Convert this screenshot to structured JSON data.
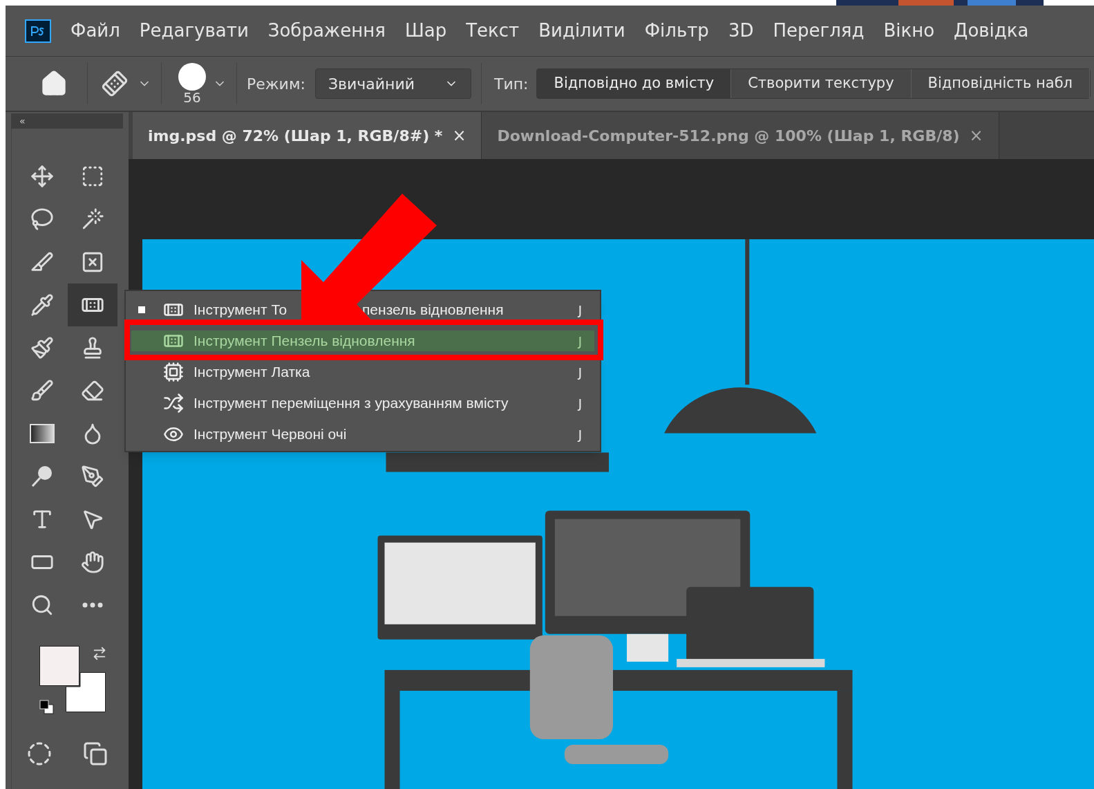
{
  "menu_bar": {
    "items": [
      "Файл",
      "Редагувати",
      "Зображення",
      "Шар",
      "Текст",
      "Виділити",
      "Фільтр",
      "3D",
      "Перегляд",
      "Вікно",
      "Довідка"
    ]
  },
  "options_bar": {
    "brush_size": "56",
    "mode_label": "Режим:",
    "mode_value": "Звичайний",
    "type_label": "Тип:",
    "type_buttons": [
      {
        "label": "Відповідно до вмісту",
        "selected": true
      },
      {
        "label": "Створити текстуру",
        "selected": false
      },
      {
        "label": "Відповідність набл",
        "selected": false
      }
    ]
  },
  "tabs": [
    {
      "title": "img.psd @ 72% (Шар 1, RGB/8#) *",
      "close": "×",
      "selected": true
    },
    {
      "title": "Download-Computer-512.png @ 100% (Шар 1, RGB/8)",
      "close": "×",
      "selected": false
    }
  ],
  "toolbar": {
    "collapse": "«",
    "tools": [
      {
        "selected": false
      },
      {
        "selected": false
      },
      {
        "selected": false
      },
      {
        "selected": false
      },
      {
        "selected": false
      },
      {
        "selected": false
      },
      {
        "selected": false
      },
      {
        "selected": true
      },
      {
        "selected": false
      },
      {
        "selected": false
      },
      {
        "selected": false
      },
      {
        "selected": false
      },
      {
        "selected": false
      },
      {
        "selected": false
      },
      {
        "selected": false
      },
      {
        "selected": false
      },
      {
        "selected": false
      },
      {
        "selected": false
      },
      {
        "selected": false
      },
      {
        "selected": false
      },
      {
        "selected": false
      },
      {
        "selected": false
      }
    ],
    "swatches": [
      {
        "color": "#f5efef"
      },
      {
        "color": "#ffffff"
      }
    ]
  },
  "tool_flyout": {
    "items": [
      {
        "label_start": "Інструмент То",
        "label_end": "пензель відновлення",
        "shortcut": "J",
        "current": true,
        "selected": false
      },
      {
        "label_start": "Інструмент Пензель відновлення",
        "shortcut": "J",
        "current": false,
        "selected": true
      },
      {
        "label_start": "Інструмент Латка",
        "shortcut": "J",
        "current": false,
        "selected": false
      },
      {
        "label_start": "Інструмент переміщення з урахуванням вмісту",
        "shortcut": "J",
        "current": false,
        "selected": false
      },
      {
        "label_start": "Інструмент Червоні очі",
        "shortcut": "J",
        "current": false,
        "selected": false
      }
    ]
  }
}
